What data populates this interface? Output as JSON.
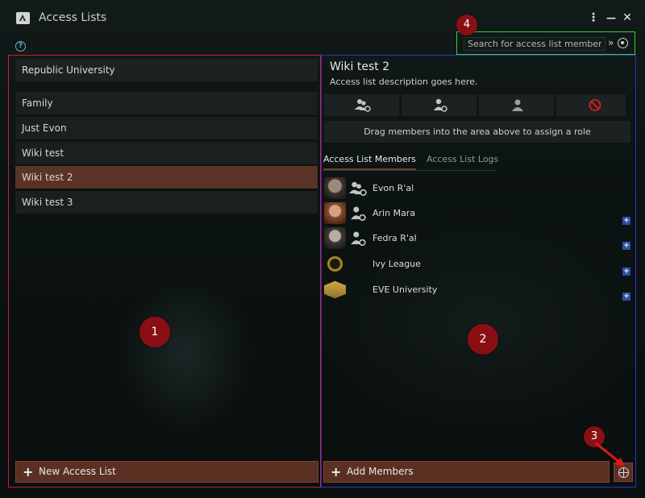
{
  "window": {
    "title": "Access Lists",
    "help_label": "?",
    "menu_label": "⋮",
    "minimize_label": "—",
    "close_label": "✕"
  },
  "search": {
    "placeholder": "Search for access list member",
    "expand_label": "»"
  },
  "left_panel": {
    "header": "Republic University",
    "items": [
      {
        "label": "Family"
      },
      {
        "label": "Just Evon"
      },
      {
        "label": "Wiki test"
      },
      {
        "label": "Wiki test 2",
        "selected": true
      },
      {
        "label": "Wiki test 3"
      }
    ],
    "new_button_label": "New Access List"
  },
  "right_panel": {
    "title": "Wiki test 2",
    "description": "Access list description goes here.",
    "roles": [
      "manager-icon",
      "admin-icon",
      "member-icon",
      "blocked-icon"
    ],
    "drag_hint": "Drag members into the area above to assign a role",
    "tabs": [
      {
        "label": "Access List Members",
        "active": true
      },
      {
        "label": "Access List Logs",
        "active": false
      }
    ],
    "members": [
      {
        "name": "Evon R'al",
        "role": "manager-icon"
      },
      {
        "name": "Arin Mara",
        "role": "admin-icon"
      },
      {
        "name": "Fedra R'al",
        "role": "admin-icon"
      },
      {
        "name": "Ivy League",
        "role": ""
      },
      {
        "name": "EVE University",
        "role": ""
      }
    ],
    "add_button_label": "Add Members"
  },
  "annotations": {
    "m1": "1",
    "m2": "2",
    "m3": "3",
    "m4": "4"
  },
  "colors": {
    "left_border": "#c8202a",
    "right_border": "#2833c8",
    "search_border": "#2ed32e",
    "accent": "#5b3023",
    "marker": "#8a0f14"
  }
}
